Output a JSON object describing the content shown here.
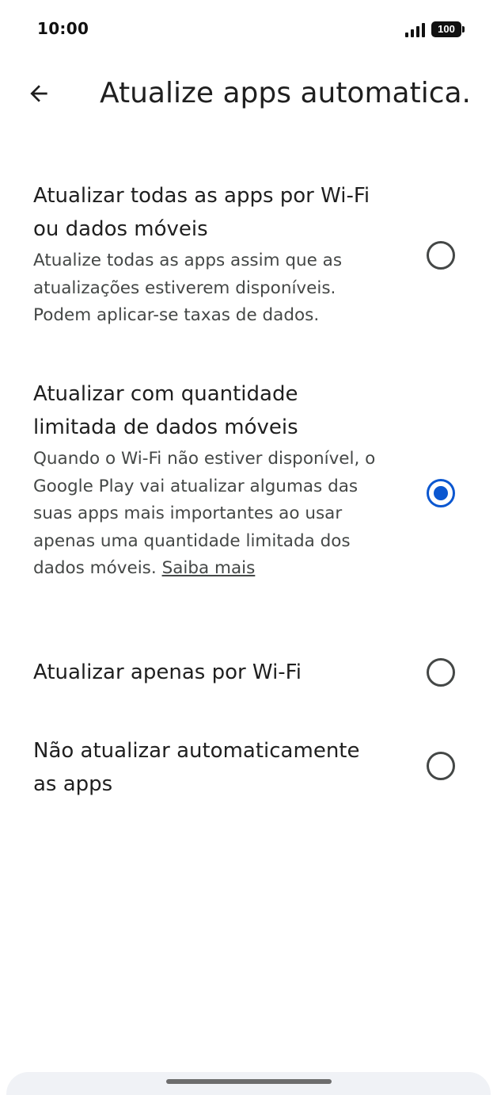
{
  "status_bar": {
    "time": "10:00",
    "battery": "100",
    "icons": [
      "signal-icon",
      "battery-icon"
    ]
  },
  "header": {
    "back_icon": "arrow-back-icon",
    "title": "Atualize apps automatica..."
  },
  "options": [
    {
      "title": "Atualizar todas as apps por Wi-Fi ou dados móveis",
      "description": "Atualize todas as apps assim que as atualizações estiverem disponíveis. Podem aplicar-se taxas de dados.",
      "selected": false
    },
    {
      "title": "Atualizar com quantidade limitada de dados móveis",
      "description": "Quando o Wi-Fi não estiver disponível, o Google Play vai atualizar algumas das suas apps mais importantes ao usar apenas uma quantidade limitada dos dados móveis.",
      "link": "Saiba mais",
      "selected": true
    },
    {
      "title": "Atualizar apenas por Wi-Fi",
      "selected": false
    },
    {
      "title": "Não atualizar automaticamente as apps",
      "selected": false
    }
  ],
  "colors": {
    "accent": "#0b57d0",
    "text_primary": "#1f1f1f",
    "text_secondary": "#444746",
    "background": "#ffffff"
  }
}
